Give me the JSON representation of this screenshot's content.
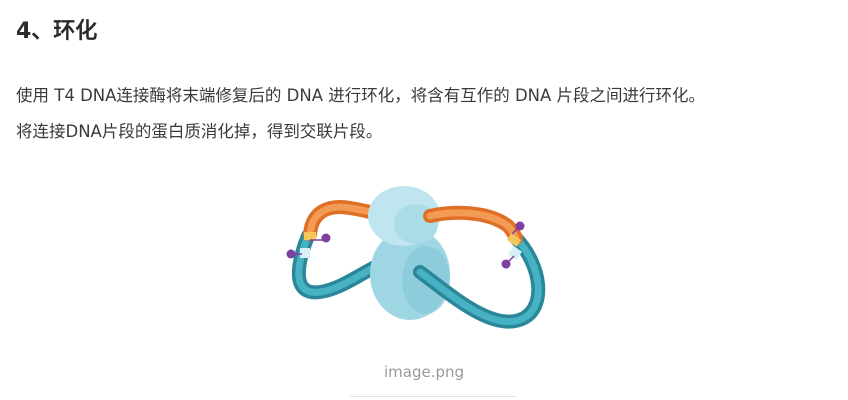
{
  "section": {
    "heading": "4、环化"
  },
  "paragraph": {
    "line1": "使用 T4 DNA连接酶将末端修复后的 DNA 进行环化，将含有互作的 DNA 片段之间进行环化。",
    "line2": "将连接DNA片段的蛋白质消化掉，得到交联片段。"
  },
  "figure": {
    "caption": "image.png",
    "colors": {
      "dna_orange": "#f0843a",
      "dna_teal": "#3aa3b4",
      "dna_teal_dark": "#2a8799",
      "protein_light": "#bfe6ee",
      "protein_mid": "#9ed7e3",
      "junction_yellow": "#f4c75a",
      "junction_light": "#d7f0f6",
      "biotin_purple": "#7e3fa0"
    }
  }
}
